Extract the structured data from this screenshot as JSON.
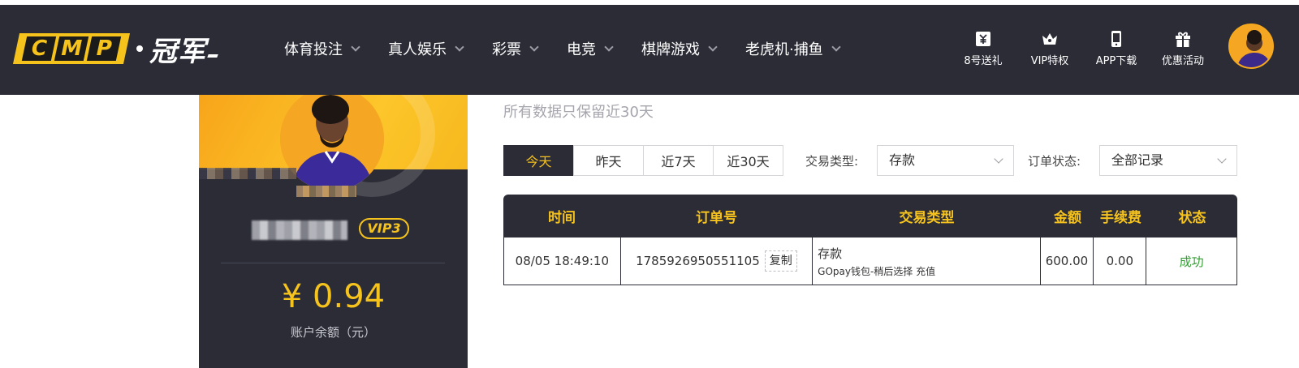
{
  "logo": {
    "letters": [
      "C",
      "M",
      "P"
    ],
    "cn": "冠军"
  },
  "nav": [
    {
      "label": "体育投注"
    },
    {
      "label": "真人娱乐"
    },
    {
      "label": "彩票"
    },
    {
      "label": "电竞"
    },
    {
      "label": "棋牌游戏"
    },
    {
      "label": "老虎机·捕鱼"
    }
  ],
  "shortcuts": [
    {
      "label": "8号送礼",
      "icon": "gift-card-icon"
    },
    {
      "label": "VIP特权",
      "icon": "crown-icon"
    },
    {
      "label": "APP下载",
      "icon": "phone-icon"
    },
    {
      "label": "优惠活动",
      "icon": "gift-box-icon"
    }
  ],
  "profile": {
    "vip": "VIP3",
    "balance": "¥ 0.94",
    "balance_label": "账户余额（元）"
  },
  "notice": "所有数据只保留近30天",
  "tabs": [
    {
      "label": "今天",
      "active": true
    },
    {
      "label": "昨天",
      "active": false
    },
    {
      "label": "近7天",
      "active": false
    },
    {
      "label": "近30天",
      "active": false
    }
  ],
  "filters": {
    "type_label": "交易类型:",
    "type_value": "存款",
    "status_label": "订单状态:",
    "status_value": "全部记录"
  },
  "table": {
    "headers": [
      "时间",
      "订单号",
      "交易类型",
      "金额",
      "手续费",
      "状态"
    ],
    "rows": [
      {
        "time": "08/05 18:49:10",
        "order_no": "1785926950551105",
        "copy_label": "复制",
        "type": "存款",
        "type_detail": "GOpay钱包-稍后选择 充值",
        "amount": "600.00",
        "fee": "0.00",
        "status": "成功"
      }
    ]
  },
  "colors": {
    "dark": "#2b2c36",
    "accent": "#f6c31d",
    "success": "#2f9e2f"
  }
}
